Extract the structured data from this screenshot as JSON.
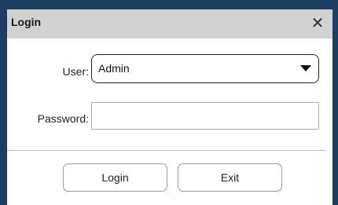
{
  "window": {
    "title": "Login",
    "close_glyph": "✕"
  },
  "form": {
    "user_label": "User:",
    "user_value": "Admin",
    "password_label": "Password:",
    "password_value": ""
  },
  "buttons": {
    "login_label": "Login",
    "exit_label": "Exit"
  },
  "colors": {
    "frame": "#1f3e63",
    "titlebar": "#d1d1d1"
  },
  "icons": {
    "close": "close-icon",
    "dropdown": "chevron-down-icon"
  }
}
